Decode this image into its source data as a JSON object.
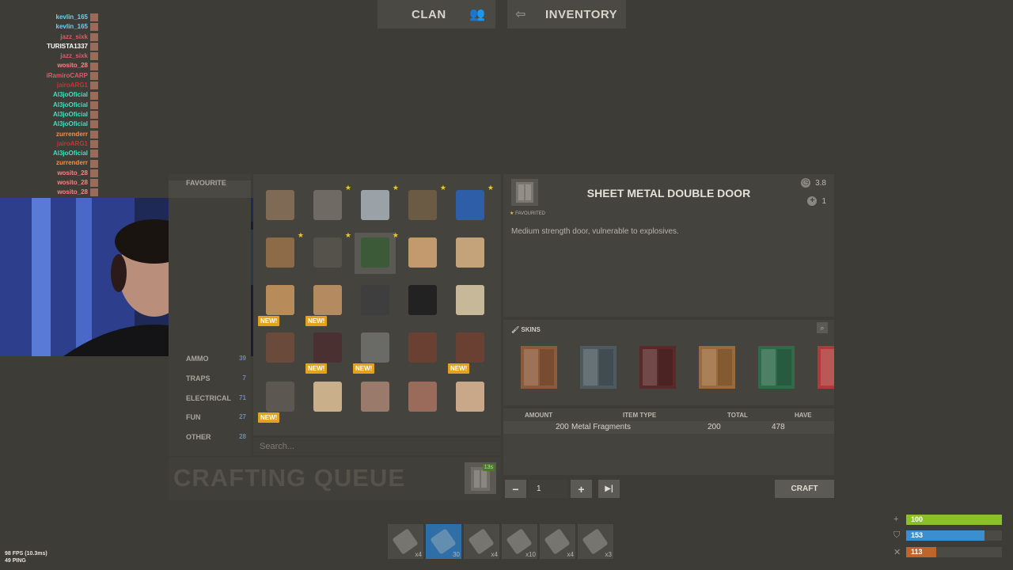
{
  "nav": {
    "clan_label": "CLAN",
    "inventory_label": "INVENTORY"
  },
  "chat": [
    {
      "name": "kevlin_165",
      "color": "#6ad2f0"
    },
    {
      "name": "kevlin_165",
      "color": "#6ad2f0"
    },
    {
      "name": "jazz_sixk",
      "color": "#e25a6a"
    },
    {
      "name": "TURISTA1337",
      "color": "#ffffff"
    },
    {
      "name": "jazz_sixk",
      "color": "#e25a6a"
    },
    {
      "name": "wosito_28",
      "color": "#ff8080"
    },
    {
      "name": "iRamiroCARP",
      "color": "#e25a6a"
    },
    {
      "name": "jairoARG1",
      "color": "#d03030"
    },
    {
      "name": "Al3joOficial",
      "color": "#3ee0c0"
    },
    {
      "name": "Al3joOficial",
      "color": "#3ee0c0"
    },
    {
      "name": "Al3joOficial",
      "color": "#3ee0c0"
    },
    {
      "name": "Al3joOficial",
      "color": "#3ee0c0"
    },
    {
      "name": "zurrenderr",
      "color": "#ff8c3a"
    },
    {
      "name": "jairoARG1",
      "color": "#d03030"
    },
    {
      "name": "Al3joOficial",
      "color": "#3ee0c0"
    },
    {
      "name": "zurrenderr",
      "color": "#ff8c3a"
    },
    {
      "name": "wosito_28",
      "color": "#ff8080"
    },
    {
      "name": "wosito_28",
      "color": "#ff8080"
    },
    {
      "name": "wosito_28",
      "color": "#ff8080"
    }
  ],
  "categories": [
    {
      "label": "FAVOURITE",
      "count": ""
    },
    {
      "label": "AMMO",
      "count": "39"
    },
    {
      "label": "TRAPS",
      "count": "7"
    },
    {
      "label": "ELECTRICAL",
      "count": "71"
    },
    {
      "label": "FUN",
      "count": "27"
    },
    {
      "label": "OTHER",
      "count": "28"
    }
  ],
  "grid": {
    "new_tag": "NEW!",
    "search_placeholder": "Search...",
    "items": [
      {
        "icon": "wood-frame-icon",
        "star": false,
        "new": false
      },
      {
        "icon": "garage-frame-icon",
        "star": true,
        "new": false
      },
      {
        "icon": "window-bars-icon",
        "star": true,
        "new": false
      },
      {
        "icon": "wooden-barricade-icon",
        "star": true,
        "new": false
      },
      {
        "icon": "tarp-icon",
        "star": true,
        "new": false
      },
      {
        "icon": "wood-door-icon",
        "star": true,
        "new": false
      },
      {
        "icon": "key-lock-icon",
        "star": true,
        "new": false
      },
      {
        "icon": "code-lock-icon",
        "star": true,
        "new": false
      },
      {
        "icon": "wooden-door-icon",
        "star": false,
        "new": false
      },
      {
        "icon": "wooden-door-icon",
        "star": false,
        "new": false
      },
      {
        "icon": "ramp-icon",
        "star": false,
        "new": true
      },
      {
        "icon": "triangle-ramp-icon",
        "star": false,
        "new": true
      },
      {
        "icon": "metal-frame-icon",
        "star": false,
        "new": false
      },
      {
        "icon": "black-frame-icon",
        "star": false,
        "new": false
      },
      {
        "icon": "shopfront-icon",
        "star": false,
        "new": false
      },
      {
        "icon": "shelf-icon",
        "star": false,
        "new": false
      },
      {
        "icon": "tall-locker-icon",
        "star": false,
        "new": true
      },
      {
        "icon": "workbench-icon",
        "star": false,
        "new": true
      },
      {
        "icon": "jail-door-icon",
        "star": false,
        "new": false
      },
      {
        "icon": "jail-cell-icon",
        "star": false,
        "new": true
      },
      {
        "icon": "window-frame-icon",
        "star": false,
        "new": true
      },
      {
        "icon": "window-grid-icon",
        "star": false,
        "new": false
      },
      {
        "icon": "metal-barricade-icon",
        "star": false,
        "new": false
      },
      {
        "icon": "metal-door-icon",
        "star": false,
        "new": false
      },
      {
        "icon": "wood-shutters-icon",
        "star": false,
        "new": false
      }
    ]
  },
  "queue": {
    "title": "CRAFTING QUEUE",
    "time": "13s"
  },
  "detail": {
    "title": "SHEET METAL DOUBLE DOOR",
    "favourited_label": "FAVOURITED",
    "description": "Medium strength door, vulnerable to explosives.",
    "craft_time": "3.8",
    "craft_amount": "1"
  },
  "skins": {
    "title": "SKINS",
    "items": [
      {
        "icon": "skin-rusty-door-icon",
        "color": "#8d5a3a"
      },
      {
        "icon": "skin-monster-door-icon",
        "color": "#4d5a5f"
      },
      {
        "icon": "skin-red-eyes-door-icon",
        "color": "#5a2a2a"
      },
      {
        "icon": "skin-painted-door-icon",
        "color": "#9a6a3a"
      },
      {
        "icon": "skin-green-door-icon",
        "color": "#2f6a4a"
      },
      {
        "icon": "skin-colorful-door-icon",
        "color": "#b03a3a"
      }
    ]
  },
  "requirements": {
    "headers": {
      "amount": "AMOUNT",
      "item_type": "ITEM TYPE",
      "total": "TOTAL",
      "have": "HAVE"
    },
    "rows": [
      {
        "amount": "200",
        "item_type": "Metal Fragments",
        "total": "200",
        "have": "478"
      }
    ]
  },
  "controls": {
    "minus": "−",
    "quantity": "1",
    "plus": "+",
    "max": "▶|",
    "craft_label": "CRAFT"
  },
  "hotbar": [
    {
      "icon": "rocket-icon",
      "count": "x4",
      "active": false
    },
    {
      "icon": "assault-rifle-icon",
      "count": "30",
      "active": true
    },
    {
      "icon": "door-icon",
      "count": "x4",
      "active": false
    },
    {
      "icon": "grenade-icon",
      "count": "x10",
      "active": false
    },
    {
      "icon": "rocket-icon",
      "count": "x4",
      "active": false
    },
    {
      "icon": "meat-icon",
      "count": "x3",
      "active": false
    }
  ],
  "status": [
    {
      "icon": "health-icon",
      "value": "100",
      "fill_pct": 100,
      "color": "#8cc027"
    },
    {
      "icon": "water-icon",
      "value": "153",
      "fill_pct": 82,
      "color": "#3b8fd0"
    },
    {
      "icon": "food-icon",
      "value": "113",
      "fill_pct": 31,
      "color": "#c0652a"
    }
  ],
  "fps": {
    "line1": "98 FPS (10.3ms)",
    "line2": "49 PING"
  }
}
